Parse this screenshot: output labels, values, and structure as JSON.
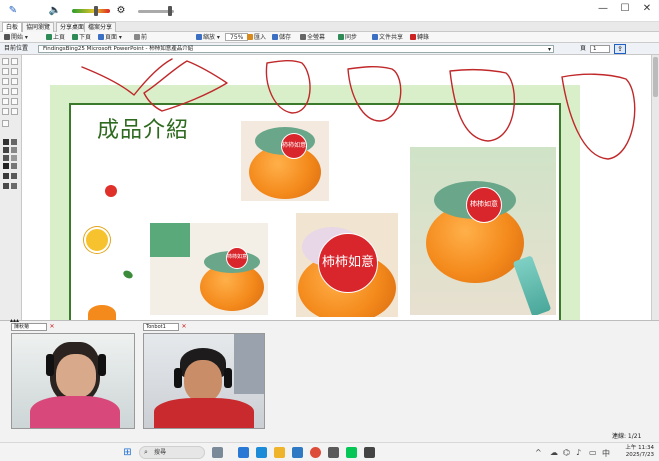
{
  "titlebar": {
    "pen_icon": "pen-icon",
    "speaker_icon": "speaker-icon",
    "settings_icon": "gear-icon",
    "volume_level": 0.62,
    "minimize": "—",
    "maximize": "☐",
    "close": "✕"
  },
  "tabs": [
    {
      "label": "白板"
    },
    {
      "label": "協同瀏覽"
    },
    {
      "label": "分享桌面"
    },
    {
      "label": "檔案分享"
    }
  ],
  "toolbar": {
    "items": [
      {
        "label": "開始"
      },
      {
        "label": "上頁"
      },
      {
        "label": "下頁"
      },
      {
        "label": "頁面"
      },
      {
        "label": "前"
      },
      {
        "label": "縮放"
      },
      {
        "label": "75%"
      },
      {
        "label": "匯入"
      },
      {
        "label": "儲存"
      },
      {
        "label": "全螢幕"
      },
      {
        "label": "同步"
      },
      {
        "label": "文件共享"
      },
      {
        "label": "轉錄"
      }
    ]
  },
  "addressbar": {
    "label": "目前位置",
    "url": "FindingsBing25 Microsoft PowerPoint - 柿柿如意產品介紹",
    "right_select": "頁",
    "right_value": "1"
  },
  "slide": {
    "title": "成品介紹",
    "tag_text": "柿柿如意"
  },
  "cameras": [
    {
      "user": "陳秋菊"
    },
    {
      "user": "Tonbot1"
    }
  ],
  "status": {
    "connected": "連線: 1/21"
  },
  "taskbar": {
    "search_placeholder": "搜尋",
    "time": "上午 11:34",
    "date": "2025/7/23"
  },
  "colors": {
    "slide_green": "#3a7a2a",
    "slide_bg": "#d9efc9",
    "annotation_red": "#c0282a",
    "persimmon": "#f48a1c"
  }
}
